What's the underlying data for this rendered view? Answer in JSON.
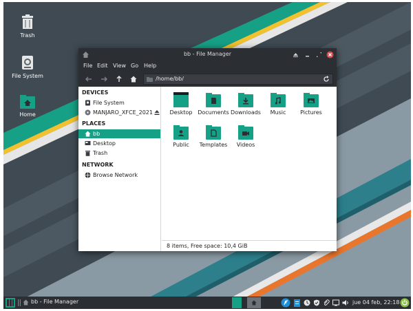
{
  "desktop": {
    "icons": [
      {
        "label": "Trash"
      },
      {
        "label": "File System"
      },
      {
        "label": "Home"
      }
    ]
  },
  "window": {
    "title": "bb - File Manager",
    "menu": [
      "File",
      "Edit",
      "View",
      "Go",
      "Help"
    ],
    "path": "/home/bb/",
    "sidebar": {
      "devices_header": "DEVICES",
      "devices": [
        "File System",
        "MANJARO_XFCE_2021"
      ],
      "places_header": "PLACES",
      "places": [
        "bb",
        "Desktop",
        "Trash"
      ],
      "network_header": "NETWORK",
      "network": [
        "Browse Network"
      ]
    },
    "files": [
      {
        "name": "Desktop"
      },
      {
        "name": "Documents"
      },
      {
        "name": "Downloads"
      },
      {
        "name": "Music"
      },
      {
        "name": "Pictures"
      },
      {
        "name": "Public"
      },
      {
        "name": "Templates"
      },
      {
        "name": "Videos"
      }
    ],
    "status": "8 items, Free space: 10,4 GiB"
  },
  "panel": {
    "task_label": "bb - File Manager",
    "clock": "jue 04 feb, 22:18"
  },
  "colors": {
    "accent": "#16a085",
    "dark": "#2b2e33",
    "close": "#e0474c"
  }
}
